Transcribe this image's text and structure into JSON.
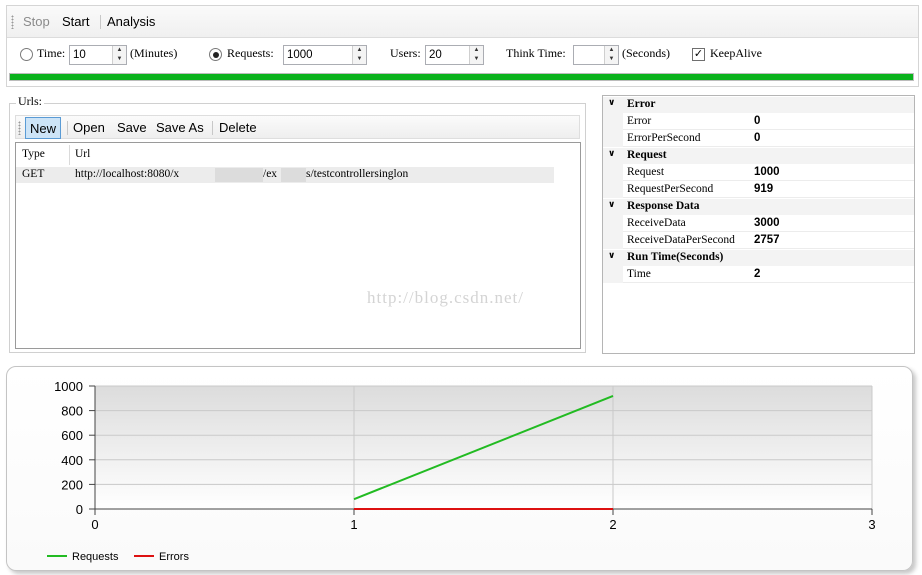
{
  "toolbar": {
    "stop_label": "Stop",
    "start_label": "Start",
    "analysis_label": "Analysis"
  },
  "options": {
    "time_label": "Time:",
    "time_value": "10",
    "time_unit": "(Minutes)",
    "requests_label": "Requests:",
    "requests_value": "1000",
    "users_label": "Users:",
    "users_value": "20",
    "think_time_label": "Think Time:",
    "think_time_value": "",
    "think_time_unit": "(Seconds)",
    "keepalive_label": "KeepAlive",
    "keepalive_checked": true,
    "selected_mode": "requests"
  },
  "progress": {
    "fraction": 1.0,
    "color": "#0ab21c"
  },
  "urls": {
    "group_title": "Urls:",
    "toolbar": {
      "new_label": "New",
      "open_label": "Open",
      "save_label": "Save",
      "save_as_label": "Save As",
      "delete_label": "Delete"
    },
    "columns": {
      "type": "Type",
      "url": "Url"
    },
    "rows": [
      {
        "type": "GET",
        "url_prefix": "http://localhost:8080/x",
        "url_mid": "/ex",
        "url_suffix": "s/testcontrollersinglon"
      }
    ]
  },
  "watermark": "http://blog.csdn.net/",
  "stats": {
    "error": {
      "title": "Error",
      "items": [
        {
          "key": "Error",
          "value": "0"
        },
        {
          "key": "ErrorPerSecond",
          "value": "0"
        }
      ]
    },
    "request": {
      "title": "Request",
      "items": [
        {
          "key": "Request",
          "value": "1000"
        },
        {
          "key": "RequestPerSecond",
          "value": "919"
        }
      ]
    },
    "response": {
      "title": "Response Data",
      "items": [
        {
          "key": "ReceiveData",
          "value": "3000"
        },
        {
          "key": "ReceiveDataPerSecond",
          "value": "2757"
        }
      ]
    },
    "runtime": {
      "title": "Run Time(Seconds)",
      "items": [
        {
          "key": "Time",
          "value": "2"
        }
      ]
    }
  },
  "chart_data": {
    "type": "line",
    "xlim": [
      0,
      3
    ],
    "ylim": [
      0,
      1000
    ],
    "x_ticks": [
      0,
      1,
      2,
      3
    ],
    "y_ticks": [
      0,
      200,
      400,
      600,
      800,
      1000
    ],
    "grid": true,
    "legend_position": "bottom-left",
    "series": [
      {
        "name": "Requests",
        "color": "#22bb22",
        "x": [
          1,
          2
        ],
        "y": [
          80,
          919
        ]
      },
      {
        "name": "Errors",
        "color": "#dd1111",
        "x": [
          1,
          2
        ],
        "y": [
          0,
          0
        ]
      }
    ]
  }
}
